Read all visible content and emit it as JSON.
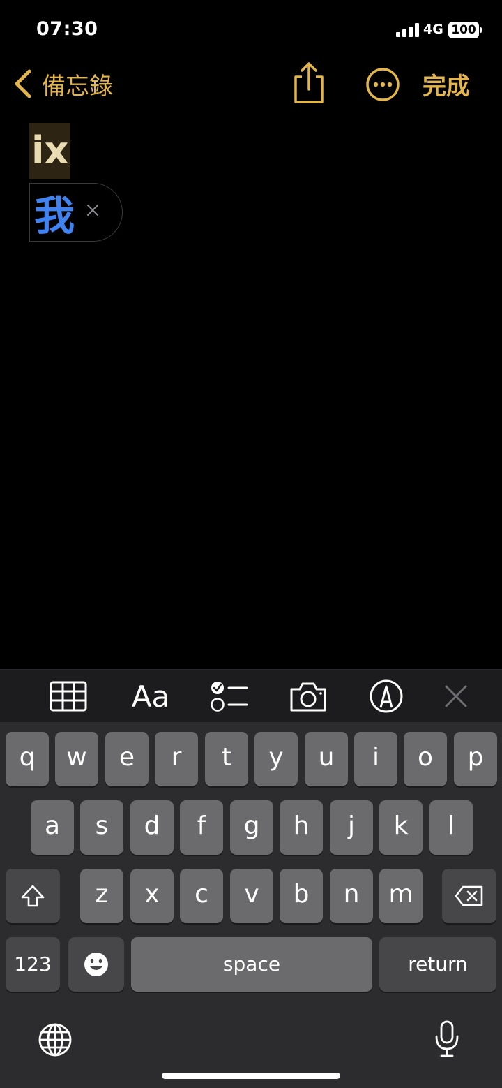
{
  "status_bar": {
    "time": "07:30",
    "network": "4G",
    "battery": "100"
  },
  "nav": {
    "back_label": "備忘錄",
    "done_label": "完成",
    "accent_color": "#e3b54d"
  },
  "editor": {
    "marked_text": "ix",
    "candidate_text": "我"
  },
  "toolbar": {
    "items": [
      "table-icon",
      "Aa",
      "checklist-icon",
      "camera-icon",
      "markup-icon",
      "close-icon"
    ],
    "format_label": "Aa"
  },
  "keyboard": {
    "row1": [
      "q",
      "w",
      "e",
      "r",
      "t",
      "y",
      "u",
      "i",
      "o",
      "p"
    ],
    "row2": [
      "a",
      "s",
      "d",
      "f",
      "g",
      "h",
      "j",
      "k",
      "l"
    ],
    "row3": [
      "z",
      "x",
      "c",
      "v",
      "b",
      "n",
      "m"
    ],
    "numbers_label": "123",
    "space_label": "space",
    "return_label": "return"
  }
}
